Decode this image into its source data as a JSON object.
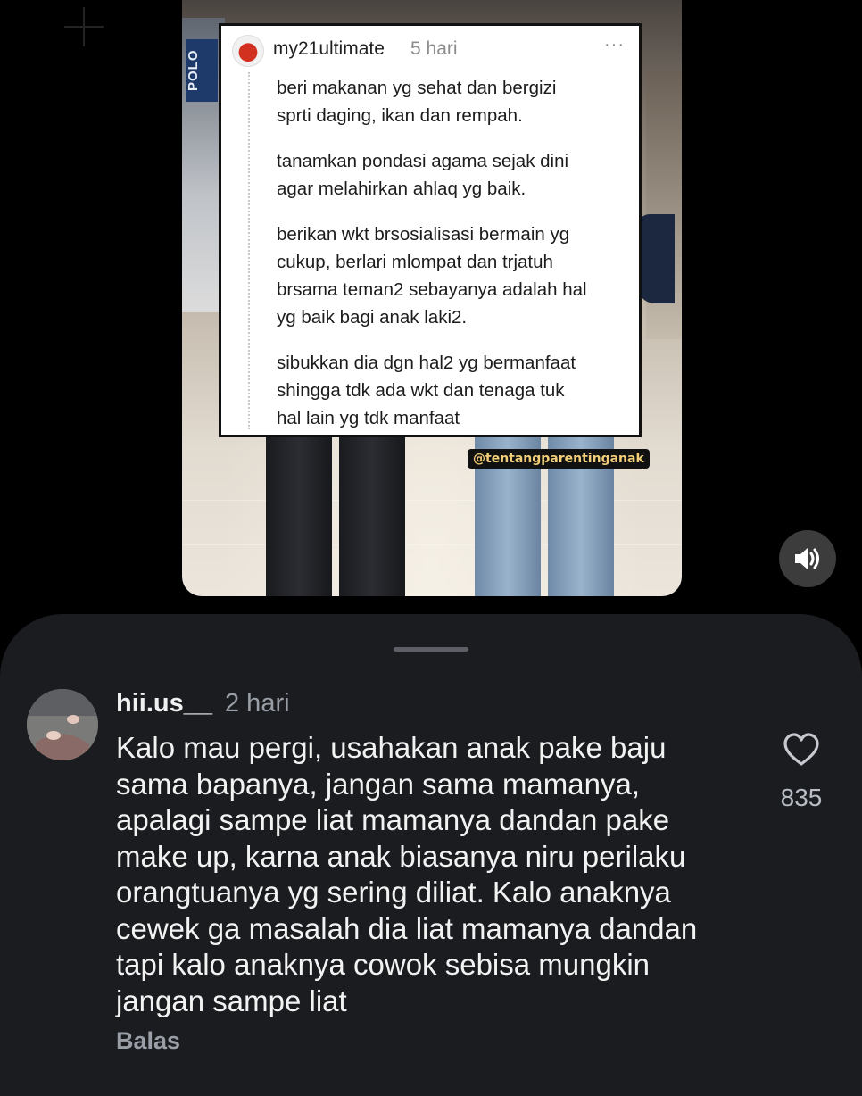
{
  "video": {
    "store_sign_text": "POLO",
    "overlay_comment": {
      "username": "my21ultimate",
      "time": "5 hari",
      "menu_label": "···",
      "paragraphs": [
        "beri makanan yg sehat dan bergizi\nsprti daging, ikan dan rempah.",
        "tanamkan pondasi agama sejak dini\nagar melahirkan ahlaq yg baik.",
        "berikan wkt brsosialisasi bermain yg\ncukup, berlari mlompat dan trjatuh\nbrsama teman2 sebayanya adalah hal\nyg baik bagi anak laki2.",
        "sibukkan dia dgn hal2 yg bermanfaat\nshingga tdk ada wkt dan tenaga tuk\nhal lain yg tdk manfaat"
      ]
    },
    "watermark": "@tentangparentinganak",
    "sound_icon": "speaker-on-icon"
  },
  "comment_sheet": {
    "comment": {
      "username": "hii.us__",
      "time": "2 hari",
      "text": "Kalo mau pergi, usahakan anak pake baju\nsama bapanya, jangan sama mamanya,\napalagi sampe liat mamanya dandan pake\nmake up, karna anak biasanya niru perilaku\norangtuanya yg sering diliat. Kalo anaknya\ncewek ga masalah dia liat mamanya dandan\ntapi kalo anaknya cowok sebisa mungkin\njangan sampe liat",
      "like_icon": "heart-outline-icon",
      "likes": "835",
      "reply_label": "Balas"
    }
  },
  "colors": {
    "sheet_bg": "#1a1c20",
    "watermark_text": "#f2cf78",
    "secondary_text": "#9a9ea6"
  }
}
